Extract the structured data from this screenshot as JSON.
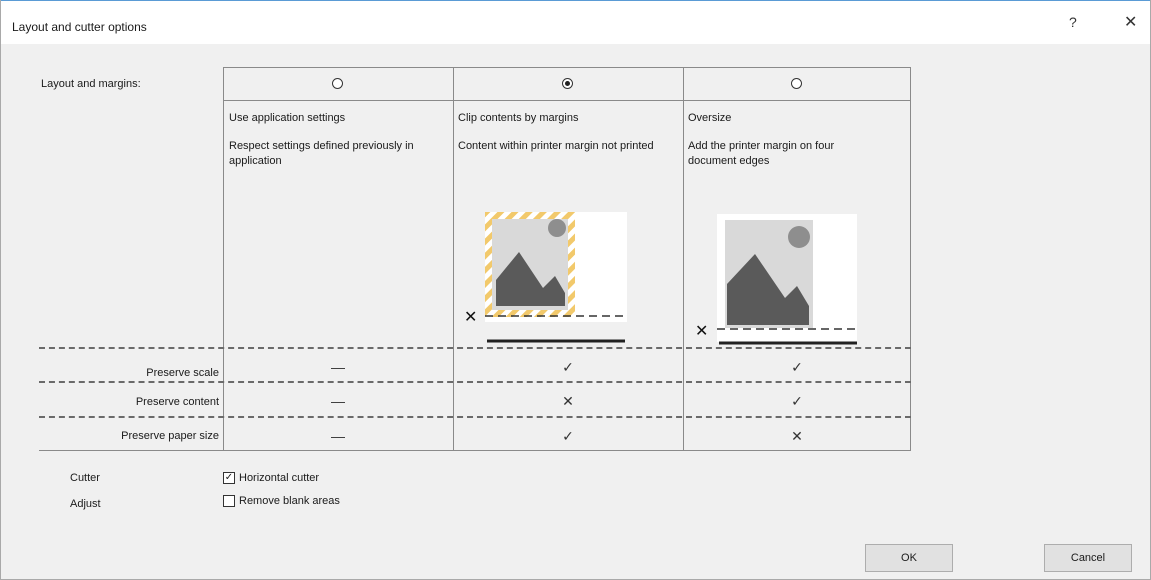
{
  "window": {
    "title": "Layout and cutter options",
    "help_label": "?",
    "close_label": "✕"
  },
  "layout": {
    "label": "Layout and margins:",
    "columns": [
      {
        "title": "Use application settings",
        "description": "Respect settings defined previously in application",
        "selected": false
      },
      {
        "title": "Clip contents by margins",
        "description": "Content within printer margin not printed",
        "selected": true
      },
      {
        "title": "Oversize",
        "description": "Add the printer margin on four document edges",
        "selected": false
      }
    ],
    "rows": [
      {
        "label": "Preserve scale",
        "values": [
          "—",
          "✓",
          "✓"
        ]
      },
      {
        "label": "Preserve content",
        "values": [
          "—",
          "✕",
          "✓"
        ]
      },
      {
        "label": "Preserve paper size",
        "values": [
          "—",
          "✓",
          "✕"
        ]
      }
    ],
    "cut_mark_glyph": "✕"
  },
  "cutter": {
    "label": "Cutter",
    "option_label": "Horizontal cutter",
    "checked": true
  },
  "adjust": {
    "label": "Adjust",
    "option_label": "Remove blank areas",
    "checked": false
  },
  "buttons": {
    "ok": "OK",
    "cancel": "Cancel"
  },
  "colors": {
    "accent_border": "#5a9bd5",
    "stripe": "#f2c96b",
    "graphic": "#5a5a5a"
  }
}
